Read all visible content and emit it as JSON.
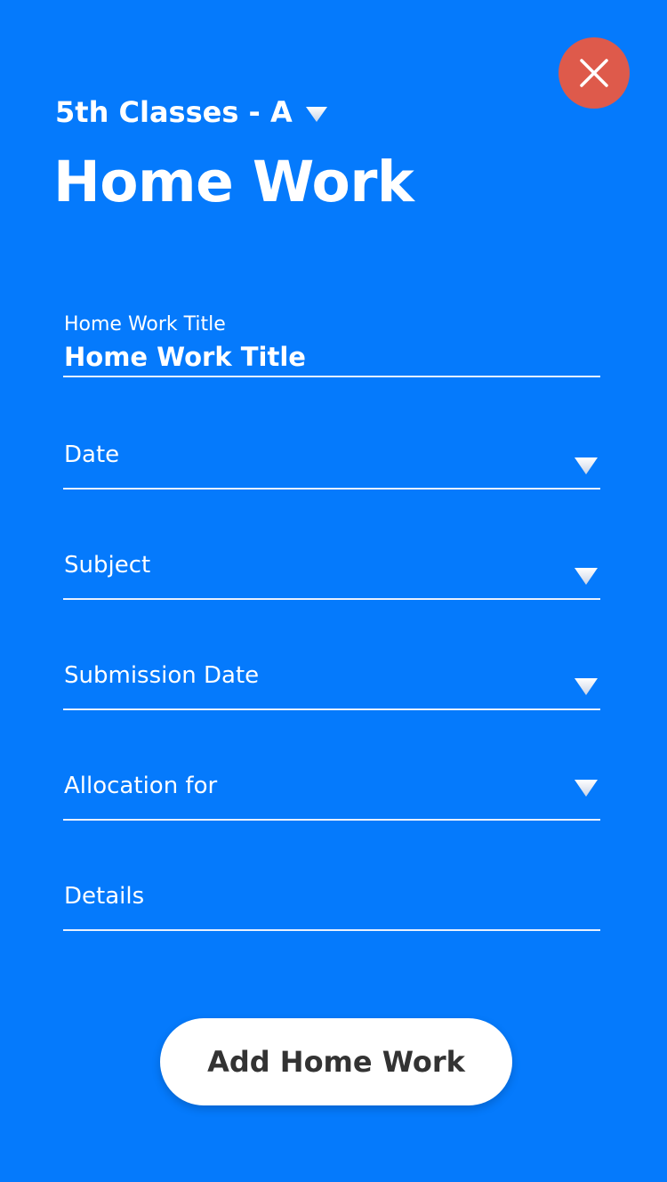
{
  "header": {
    "class_selector_label": "5th Classes - A",
    "title": "Home Work"
  },
  "form": {
    "title_field": {
      "label": "Home Work Title",
      "value": "Home Work Title"
    },
    "date_field": {
      "placeholder": "Date"
    },
    "subject_field": {
      "placeholder": "Subject"
    },
    "submission_date_field": {
      "placeholder": "Submission Date"
    },
    "allocation_field": {
      "placeholder": "Allocation for"
    },
    "details_field": {
      "placeholder": "Details"
    }
  },
  "actions": {
    "add_label": "Add Home Work"
  },
  "icons": {
    "close": "close-icon",
    "dropdown": "triangle-down-icon"
  },
  "colors": {
    "background": "#057AFC",
    "close_button": "#DE5A4B",
    "button_bg": "#FFFFFF",
    "button_text": "#333333"
  }
}
